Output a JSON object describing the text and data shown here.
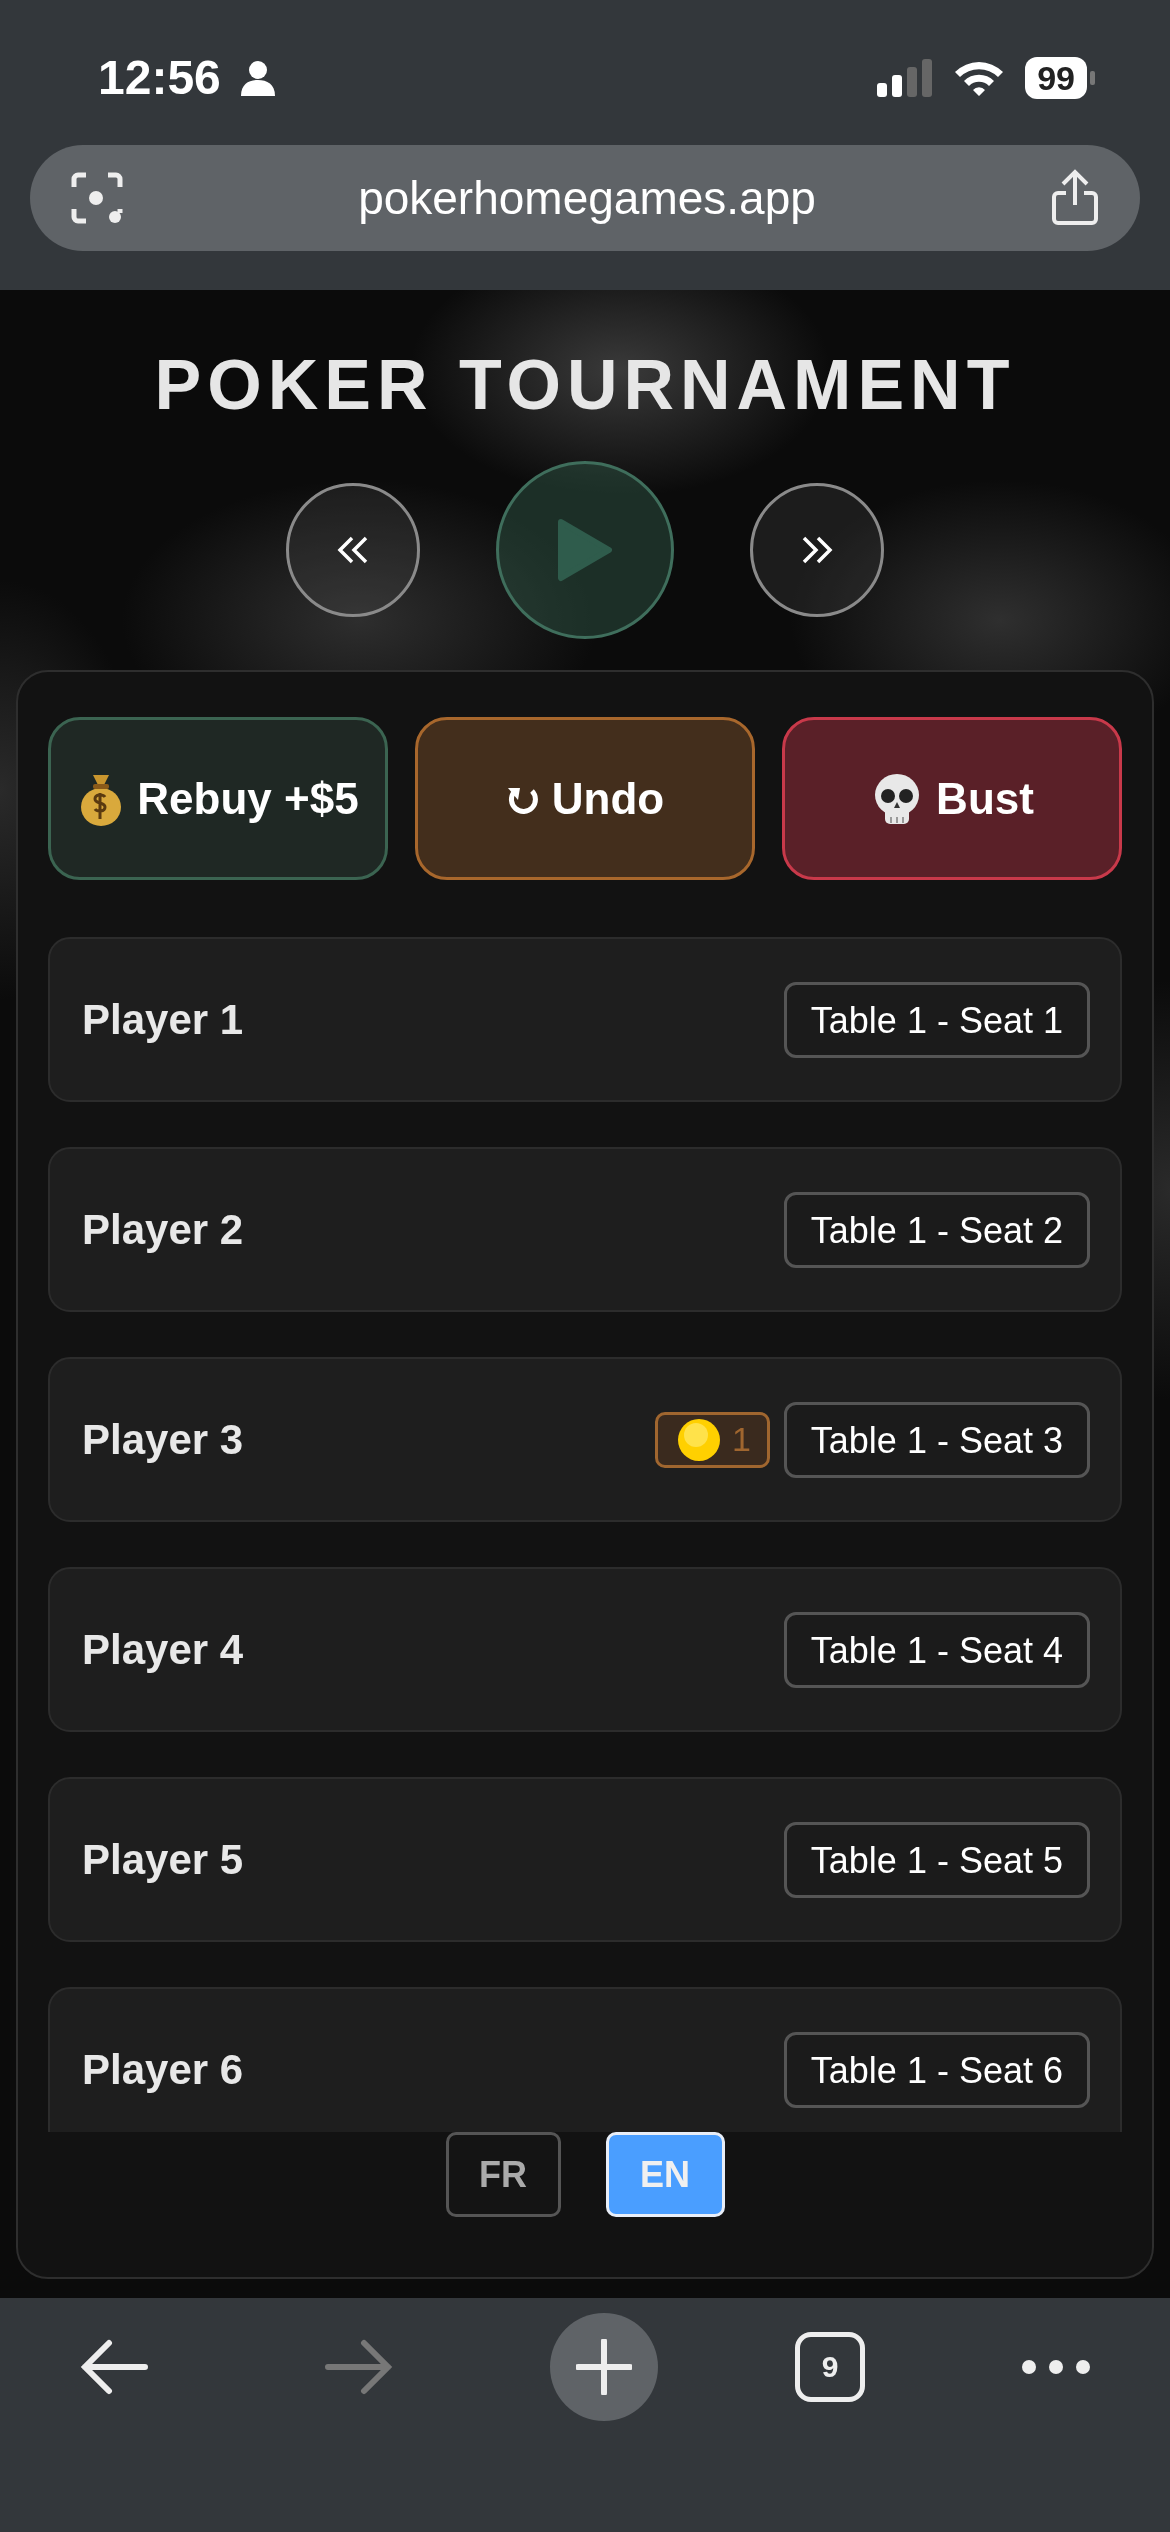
{
  "status_bar": {
    "time": "12:56",
    "battery": "99"
  },
  "browser": {
    "url": "pokerhomegames.app",
    "tab_count": "9"
  },
  "header": {
    "title": "POKER TOURNAMENT"
  },
  "actions": [
    {
      "kind": "rebuy",
      "label": "Rebuy +$5"
    },
    {
      "kind": "undo",
      "label": "Undo"
    },
    {
      "kind": "bust",
      "label": "Bust"
    }
  ],
  "players": [
    {
      "name": "Player 1",
      "seat": "Table 1 - Seat 1"
    },
    {
      "name": "Player 2",
      "seat": "Table 1 - Seat 2"
    },
    {
      "name": "Player 3",
      "seat": "Table 1 - Seat 3",
      "rebuys": "1"
    },
    {
      "name": "Player 4",
      "seat": "Table 1 - Seat 4"
    },
    {
      "name": "Player 5",
      "seat": "Table 1 - Seat 5"
    },
    {
      "name": "Player 6",
      "seat": "Table 1 - Seat 6"
    }
  ],
  "languages": [
    {
      "label": "FR",
      "selected": false
    },
    {
      "label": "EN",
      "selected": true
    }
  ]
}
